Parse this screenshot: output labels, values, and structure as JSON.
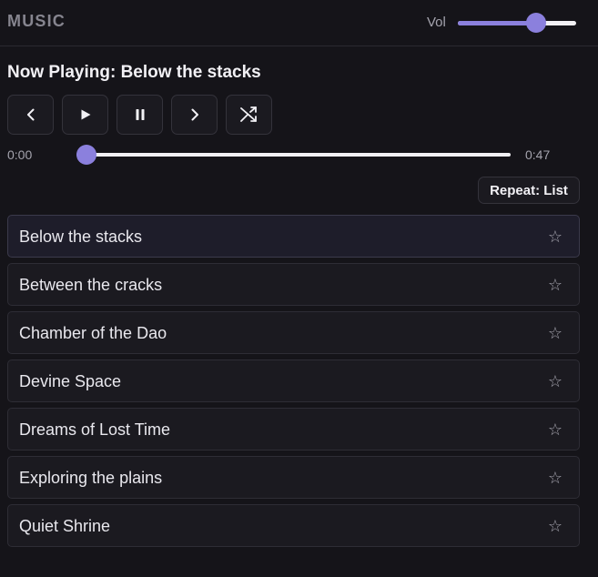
{
  "header": {
    "title": "MUSIC",
    "volume_label": "Vol",
    "volume_fraction": 0.66
  },
  "player": {
    "now_playing": "Now Playing: Below the stacks",
    "current_time": "0:00",
    "total_time": "0:47",
    "progress_fraction": 0.0,
    "repeat_label": "Repeat: List",
    "controls": [
      "previous",
      "play",
      "pause",
      "next",
      "shuffle"
    ]
  },
  "colors": {
    "accent": "#8b80dd",
    "background": "#151419",
    "card": "#1b1a20"
  },
  "tracks": [
    {
      "name": "Below the stacks",
      "active": true
    },
    {
      "name": "Between the cracks",
      "active": false
    },
    {
      "name": "Chamber of the Dao",
      "active": false
    },
    {
      "name": "Devine Space",
      "active": false
    },
    {
      "name": "Dreams of Lost Time",
      "active": false
    },
    {
      "name": "Exploring the plains",
      "active": false
    },
    {
      "name": "Quiet Shrine",
      "active": false
    }
  ],
  "icons": {
    "favorite": "☆"
  }
}
